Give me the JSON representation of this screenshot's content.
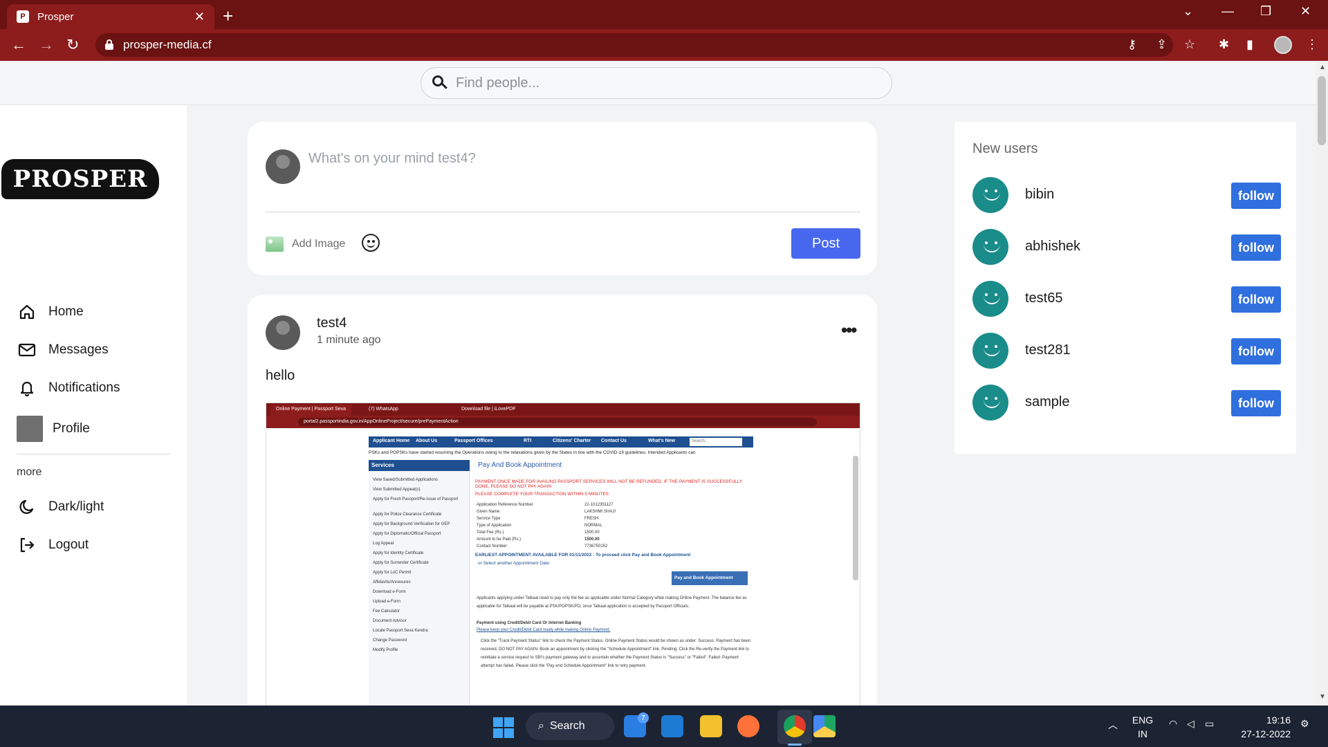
{
  "browser": {
    "tab_title": "Prosper",
    "url": "prosper-media.cf"
  },
  "search": {
    "placeholder": "Find people..."
  },
  "sidebar": {
    "logo": "PROSPER",
    "items": [
      {
        "label": "Home",
        "icon": "home-icon"
      },
      {
        "label": "Messages",
        "icon": "mail-icon"
      },
      {
        "label": "Notifications",
        "icon": "bell-icon"
      },
      {
        "label": "Profile",
        "icon": "profile-thumbnail"
      }
    ],
    "more_label": "more",
    "more_items": [
      {
        "label": "Dark/light",
        "icon": "moon-icon"
      },
      {
        "label": "Logout",
        "icon": "logout-icon"
      }
    ]
  },
  "composer": {
    "placeholder": "What's on your mind test4?",
    "add_image_label": "Add Image",
    "post_label": "Post"
  },
  "post": {
    "username": "test4",
    "time": "1 minute ago",
    "text": "hello",
    "image": {
      "tabs": [
        "Online Payment | Passport Seva",
        "(7) WhatsApp",
        "Download file | iLovePDF"
      ],
      "url": "portal2.passportindia.gov.in/AppOnlineProject/secure/prePaymentAction",
      "nav": [
        "Applicant Home",
        "About Us",
        "Passport Offices",
        "RTI",
        "Citizens' Charter",
        "Contact Us",
        "What's New"
      ],
      "search": "Search...",
      "ticker": "PSKs and POPSKs have started resuming the Operations owing to the relaxations given by the States in line with the COVID-19 guidelines. Intended Applicants can",
      "services_title": "Services",
      "services": [
        "View Saved/Submitted Applications",
        "View Submitted Appeal(s)",
        "Apply for Fresh Passport/Re-issue of Passport",
        "Apply for Police Clearance Certificate",
        "Apply for Background Verification for GEP",
        "Apply for Diplomatic/Official Passport",
        "Log Appeal",
        "Apply for Identity Certificate",
        "Apply for Surrender Certificate",
        "Apply for LoC Permit",
        "Affidavits/Annexures",
        "Download e-Form",
        "Upload e-Form",
        "Fee Calculator",
        "Document Advisor",
        "Locate Passport Seva Kendra",
        "Change Password",
        "Modify Profile"
      ],
      "title": "Pay And Book Appointment",
      "warning": "PAYMENT ONCE MADE FOR AVAILING PASSPORT SERVICES WILL NOT BE REFUNDED. IF THE PAYMENT IS SUCCESSFULLY DONE, PLEASE DO NOT PAY AGAIN",
      "warning2": "PLEASE COMPLETE YOUR TRANSACTION WITHIN 5 MINUTES",
      "rows": [
        {
          "k": "Application Reference Number",
          "v": "22-1012351127"
        },
        {
          "k": "Given Name",
          "v": "LAKSHMI SHAJI"
        },
        {
          "k": "Service Type",
          "v": "FRESH"
        },
        {
          "k": "Type of Application",
          "v": "NORMAL"
        },
        {
          "k": "Total Fee (Rs.)",
          "v": "1500.00"
        },
        {
          "k": "Amount to be Paid (Rs.)",
          "v": "1500.00"
        },
        {
          "k": "Contact Number",
          "v": "7736750252"
        }
      ],
      "earliest": "EARLIEST APPOINTMENT AVAILABLE FOR 01/11/2022 : To proceed click Pay and Book Appointment",
      "select_date": "or Select another Appointment Date",
      "pay_button": "Pay and Book Appointment",
      "tatkaal": "Applicants applying under Tatkaal need to pay only the fee as applicable under Normal Category while making Online Payment. The balance fee as applicable for Tatkaal will be payable at PSK/POPSK/PO, once Tatkaal application is accepted by Passport Officials.",
      "payment_head": "Payment using Credit/Debit Card Or Internet Banking",
      "payment_sub": "Please keep your Credit/Debit Card ready while making Online Payment.",
      "steps": "Click the \"Track Payment Status\" link to check the Payment Status. Online Payment Status would be shown as under: Success: Payment has been received. DO NOT PAY AGAIN. Book an appointment by clicking the \"Schedule Appointment\" link. Pending: Click the Re-verify the Payment link to reinitiate a service request to SBI's payment gateway and to ascertain whether the Payment Status is \"Success\" or \"Failed\". Failed: Payment attempt has failed. Please click the \"Pay and Schedule Appointment\" link to retry payment."
    }
  },
  "new_users": {
    "title": "New users",
    "follow_label": "follow",
    "users": [
      "bibin",
      "abhishek",
      "test65",
      "test281",
      "sample"
    ]
  },
  "taskbar": {
    "search_label": "Search",
    "mail_badge": "7",
    "lang_line1": "ENG",
    "lang_line2": "IN",
    "time": "19:16",
    "date": "27-12-2022"
  },
  "colors": {
    "browser_frame": "#6b1212",
    "primary_button": "#4768ee",
    "follow_button": "#2f6fde",
    "avatar_teal": "#1a8c8a"
  }
}
